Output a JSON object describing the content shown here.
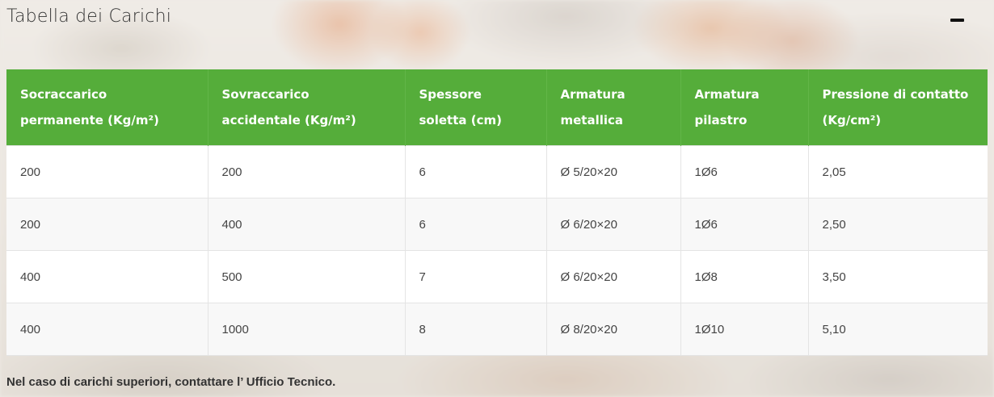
{
  "section": {
    "title": "Tabella dei Carichi"
  },
  "table": {
    "headers": [
      "Socraccarico permanente (Kg/m²)",
      "Sovraccarico accidentale (Kg/m²)",
      "Spessore soletta (cm)",
      "Armatura metallica",
      "Armatura pilastro",
      "Pressione di contatto (Kg/cm²)"
    ],
    "rows": [
      [
        "200",
        "200",
        "6",
        "Ø 5/20×20",
        "1Ø6",
        "2,05"
      ],
      [
        "200",
        "400",
        "6",
        "Ø 6/20×20",
        "1Ø6",
        "2,50"
      ],
      [
        "400",
        "500",
        "7",
        "Ø 6/20×20",
        "1Ø8",
        "3,50"
      ],
      [
        "400",
        "1000",
        "8",
        "Ø 8/20×20",
        "1Ø10",
        "5,10"
      ]
    ]
  },
  "footnote": "Nel caso di carichi superiori, contattare l’ Ufficio Tecnico.",
  "colors": {
    "header_green": "#55ad3a",
    "row_alt": "#f8f8f8"
  },
  "icons": {
    "collapse": "minus-icon"
  }
}
